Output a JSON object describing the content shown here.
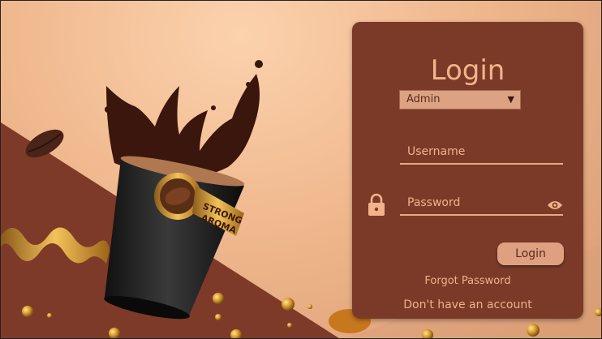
{
  "login": {
    "title": "Login",
    "role_select": {
      "selected": "Admin"
    },
    "username": {
      "placeholder": "Username",
      "value": ""
    },
    "password": {
      "placeholder": "Password",
      "value": ""
    },
    "login_button": "Login",
    "forgot_password": "Forgot Password",
    "no_account": "Don't have an account"
  },
  "artwork": {
    "cup_label": [
      "STRONG",
      "AROMA"
    ]
  },
  "colors": {
    "panel": "#7b3a28",
    "accent": "#f2b38a",
    "button": "#dea080",
    "background": "#f0b88e"
  },
  "icons": [
    "lock-icon",
    "eye-icon",
    "dropdown-caret-icon"
  ]
}
